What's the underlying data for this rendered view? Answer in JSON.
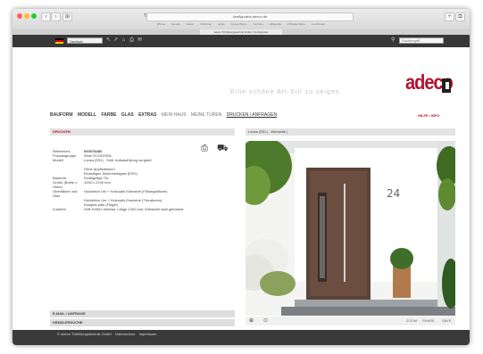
{
  "browser": {
    "url": "konfigurator.adeco.de",
    "tab_title": "adeco Türfüllungstechnik GmbH: Konfigurator",
    "bookmarks": [
      "iPhone",
      "Google",
      "Adeco",
      "IT-Banner",
      "Apple",
      "Suisse Baum",
      "YouTube",
      "Wikipedia",
      "Offizielle Werte",
      "Link Bruder"
    ],
    "nav_back": "‹",
    "nav_fwd": "›",
    "sidebar": "⊞",
    "reload": "↻",
    "plus": "+",
    "tabs_overview": "⧉"
  },
  "topbar": {
    "language": "Deutsch",
    "search_placeholder": "Suchbegriff",
    "colors": {
      "bar": "#373737"
    }
  },
  "header": {
    "tagline": "Eine schöne Art Stil zu zeigen.",
    "logo_text": "adeco",
    "brand_color": "#b5122e"
  },
  "mainnav": {
    "items": [
      {
        "label": "BAUFORM",
        "style": "bold"
      },
      {
        "label": "MODELL",
        "style": "bold"
      },
      {
        "label": "FARBE",
        "style": "bold"
      },
      {
        "label": "GLAS",
        "style": "bold"
      },
      {
        "label": "EXTRAS",
        "style": "bold"
      },
      {
        "label": "MEIN HAUS",
        "style": "light"
      },
      {
        "label": "MEINE TÜREN",
        "style": "light"
      },
      {
        "label": "DRUCKEN / ANFRAGEN",
        "style": "active"
      }
    ],
    "help": "HILFE / INFO"
  },
  "left": {
    "section_title": "DRUCKEN",
    "rows": [
      {
        "label": "Referenznr.",
        "value": "060078480",
        "bold": true
      },
      {
        "label": "Produktgruppe",
        "value": "Serie ECODORA"
      },
      {
        "label": "Modell",
        "value": "Lonza (E51) , Seitl. Aufsatzfüllung vergütet"
      },
      {
        "label": "",
        "value": "Ohne Applikationen"
      },
      {
        "label": "",
        "value": "Einseitiges Sicherheitsglas (ESG)"
      },
      {
        "label": "Bauform",
        "value": "Einflügelige Tür"
      },
      {
        "label": "Größe (Breite x Höhe)",
        "value": "1000 x 2100 mm"
      },
      {
        "label": "Oberfläche und Glas",
        "value": "Holzdekor Uni + Holzoptik Eiserstrie (Füllungsfläche)"
      },
      {
        "label": "",
        "value": "Holzdekor Uni + Holzoptik Eiserstrie (Türrahmen)"
      },
      {
        "label": "",
        "value": "Klarglas plan (Flügel)"
      },
      {
        "label": "Zubehör",
        "value": "Griff H4501 drehbar, Länge 1400 mm, Edelstahl matt gebürstet"
      }
    ],
    "bottom_bars": [
      "E-MAIL / ANFRAGE",
      "HÄNDLERSUCHE"
    ]
  },
  "right": {
    "title": "Lonza (E51) - Wonsatle |",
    "house_number": "24",
    "toolbar": {
      "zoom": "⊕",
      "arrow": "⊙",
      "b1": "ZOOM",
      "b2": "SHARE",
      "b3": "SAVE"
    }
  },
  "footer": {
    "copyright": "© adeco Türfüllungstechnik GmbH",
    "links": [
      "Datenschutz",
      "Impressum"
    ]
  }
}
